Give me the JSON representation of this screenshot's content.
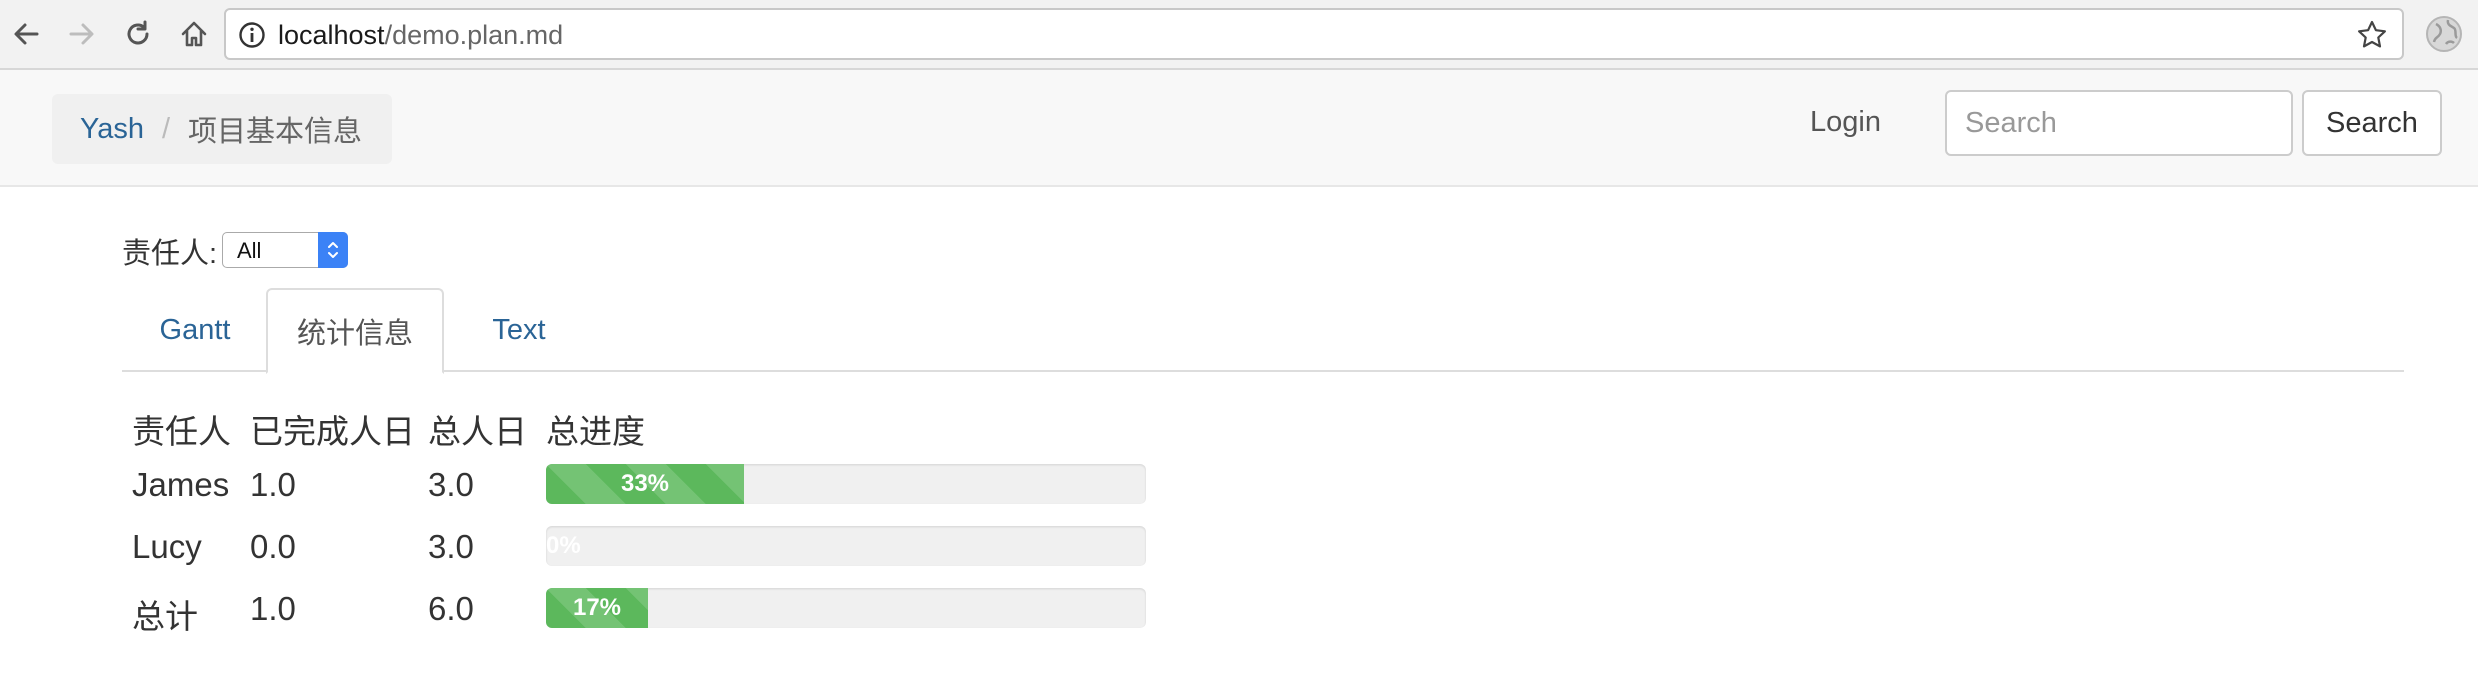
{
  "browser": {
    "url_host": "localhost",
    "url_path": "/demo.plan.md",
    "icons": [
      "back-icon",
      "forward-icon",
      "reload-icon",
      "home-icon",
      "info-icon",
      "star-icon",
      "globe-icon"
    ]
  },
  "navbar": {
    "breadcrumb": [
      "Yash",
      "项目基本信息"
    ],
    "login_label": "Login",
    "search_placeholder": "Search",
    "search_button_label": "Search"
  },
  "filter": {
    "label": "责任人:",
    "selected": "All"
  },
  "tabs": [
    {
      "label": "Gantt",
      "active": false
    },
    {
      "label": "统计信息",
      "active": true
    },
    {
      "label": "Text",
      "active": false
    }
  ],
  "stats": {
    "headers": [
      "责任人",
      "已完成人日",
      "总人日",
      "总进度"
    ],
    "rows": [
      {
        "name": "James",
        "done": "1.0",
        "total": "3.0",
        "progress": 33,
        "progress_label": "33%"
      },
      {
        "name": "Lucy",
        "done": "0.0",
        "total": "3.0",
        "progress": 0,
        "progress_label": "0%"
      },
      {
        "name": "总计",
        "done": "1.0",
        "total": "6.0",
        "progress": 17,
        "progress_label": "17%"
      }
    ]
  },
  "colors": {
    "link": "#2a6496",
    "progress_fill": "#5cb85c",
    "progress_track": "#f0f0f0",
    "select_accent": "#3b82f6"
  }
}
